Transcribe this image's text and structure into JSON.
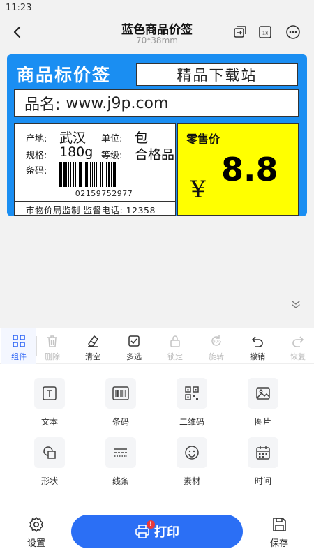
{
  "status_bar": {
    "time": "11:23"
  },
  "header": {
    "title": "蓝色商品价签",
    "subtitle": "70*38mm"
  },
  "label": {
    "title": "商品标价签",
    "store": "精品下载站",
    "name_key": "品名:",
    "name_value": "www.j9p.com",
    "origin_key": "产地:",
    "origin_value": "武汉",
    "unit_key": "单位:",
    "unit_value": "包",
    "spec_key": "规格:",
    "spec_value": "180g",
    "grade_key": "等级:",
    "grade_value": "合格品",
    "barcode_key": "条码:",
    "barcode_number": "02159752977",
    "supervision": "市物价局监制 监督电话: 12358",
    "price_label": "零售价",
    "currency": "¥",
    "price": "8.8",
    "colors": {
      "frame": "#1a8ef2",
      "price_bg": "#ffff00"
    }
  },
  "toolbar": {
    "items": [
      {
        "label": "组件",
        "icon": "grid-icon",
        "active": true
      },
      {
        "label": "删除",
        "icon": "trash-icon",
        "disabled": true
      },
      {
        "label": "清空",
        "icon": "eraser-icon"
      },
      {
        "label": "多选",
        "icon": "multi-select-icon"
      },
      {
        "label": "锁定",
        "icon": "lock-icon",
        "disabled": true
      },
      {
        "label": "旋转",
        "icon": "rotate-icon",
        "disabled": true
      },
      {
        "label": "撤销",
        "icon": "undo-icon"
      },
      {
        "label": "恢复",
        "icon": "redo-icon",
        "disabled": true
      }
    ]
  },
  "components": [
    {
      "label": "文本",
      "icon": "text-icon"
    },
    {
      "label": "条码",
      "icon": "barcode-icon"
    },
    {
      "label": "二维码",
      "icon": "qrcode-icon"
    },
    {
      "label": "图片",
      "icon": "image-icon"
    },
    {
      "label": "形状",
      "icon": "shape-icon"
    },
    {
      "label": "线条",
      "icon": "line-icon"
    },
    {
      "label": "素材",
      "icon": "material-icon"
    },
    {
      "label": "时间",
      "icon": "calendar-icon"
    }
  ],
  "bottom_bar": {
    "settings_label": "设置",
    "print_label": "打印",
    "print_badge": "!",
    "save_label": "保存"
  },
  "accent_color": "#2b6ff5"
}
